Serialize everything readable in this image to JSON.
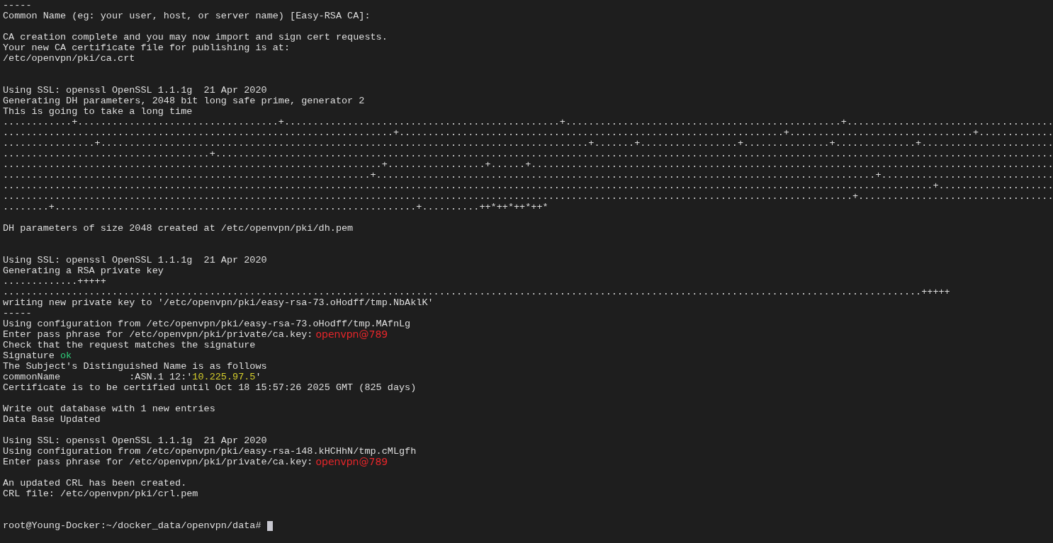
{
  "terminal": {
    "cursor": true,
    "lines": [
      {
        "kind": "text",
        "segments": [
          {
            "kind": "output",
            "text": "-----"
          }
        ]
      },
      {
        "kind": "text",
        "segments": [
          {
            "kind": "output",
            "text": "Common Name (eg: your user, host, or server name) [Easy-RSA CA]:"
          }
        ]
      },
      {
        "kind": "blank"
      },
      {
        "kind": "text",
        "segments": [
          {
            "kind": "output",
            "text": "CA creation complete and you may now import and sign cert requests."
          }
        ]
      },
      {
        "kind": "text",
        "segments": [
          {
            "kind": "output",
            "text": "Your new CA certificate file for publishing is at:"
          }
        ]
      },
      {
        "kind": "text",
        "segments": [
          {
            "kind": "output",
            "text": "/etc/openvpn/pki/ca.crt"
          }
        ]
      },
      {
        "kind": "blank"
      },
      {
        "kind": "blank"
      },
      {
        "kind": "text",
        "segments": [
          {
            "kind": "output",
            "text": "Using SSL: openssl OpenSSL 1.1.1g  21 Apr 2020"
          }
        ]
      },
      {
        "kind": "text",
        "segments": [
          {
            "kind": "output",
            "text": "Generating DH parameters, 2048 bit long safe prime, generator 2"
          }
        ]
      },
      {
        "kind": "text",
        "segments": [
          {
            "kind": "output",
            "text": "This is going to take a long time"
          }
        ]
      },
      {
        "kind": "text",
        "segments": [
          {
            "kind": "output",
            "text": "............+...................................+................................................+................................................+...................................."
          }
        ]
      },
      {
        "kind": "text",
        "segments": [
          {
            "kind": "output",
            "text": "....................................................................+...................................................................+................................+............."
          }
        ]
      },
      {
        "kind": "text",
        "segments": [
          {
            "kind": "output",
            "text": "................+.....................................................................................+.......+.................+...............+..............+......................."
          }
        ]
      },
      {
        "kind": "text",
        "segments": [
          {
            "kind": "output",
            "text": "....................................+.................................................................................................................................................."
          }
        ]
      },
      {
        "kind": "text",
        "segments": [
          {
            "kind": "output",
            "text": "..................................................................+.................+......+..........................................................................................."
          }
        ]
      },
      {
        "kind": "text",
        "segments": [
          {
            "kind": "output",
            "text": "................................................................+.......................................................................................+.............................."
          }
        ]
      },
      {
        "kind": "text",
        "segments": [
          {
            "kind": "output",
            "text": "..................................................................................................................................................................+...................."
          }
        ]
      },
      {
        "kind": "text",
        "segments": [
          {
            "kind": "output",
            "text": "....................................................................................................................................................+.................................."
          }
        ]
      },
      {
        "kind": "text",
        "segments": [
          {
            "kind": "output",
            "text": "........+...............................................................+..........++*++*++*++*"
          }
        ]
      },
      {
        "kind": "blank"
      },
      {
        "kind": "text",
        "segments": [
          {
            "kind": "output",
            "text": "DH parameters of size 2048 created at /etc/openvpn/pki/dh.pem"
          }
        ]
      },
      {
        "kind": "blank"
      },
      {
        "kind": "blank"
      },
      {
        "kind": "text",
        "segments": [
          {
            "kind": "output",
            "text": "Using SSL: openssl OpenSSL 1.1.1g  21 Apr 2020"
          }
        ]
      },
      {
        "kind": "text",
        "segments": [
          {
            "kind": "output",
            "text": "Generating a RSA private key"
          }
        ]
      },
      {
        "kind": "text",
        "segments": [
          {
            "kind": "output",
            "text": ".............+++++"
          }
        ]
      },
      {
        "kind": "text",
        "segments": [
          {
            "kind": "output",
            "text": "................................................................................................................................................................+++++"
          }
        ]
      },
      {
        "kind": "text",
        "segments": [
          {
            "kind": "output",
            "text": "writing new private key to '/etc/openvpn/pki/easy-rsa-73.oHodff/tmp.NbAklK'"
          }
        ]
      },
      {
        "kind": "text",
        "segments": [
          {
            "kind": "output",
            "text": "-----"
          }
        ]
      },
      {
        "kind": "text",
        "segments": [
          {
            "kind": "output",
            "text": "Using configuration from /etc/openvpn/pki/easy-rsa-73.oHodff/tmp.MAfnLg"
          }
        ]
      },
      {
        "kind": "text",
        "segments": [
          {
            "kind": "output",
            "text": "Enter pass phrase for /etc/openvpn/pki/private/ca.key:"
          },
          {
            "kind": "password",
            "text": "openvpn@789"
          }
        ]
      },
      {
        "kind": "text",
        "segments": [
          {
            "kind": "output",
            "text": "Check that the request matches the signature"
          }
        ]
      },
      {
        "kind": "text",
        "segments": [
          {
            "kind": "output",
            "text": "Signature"
          },
          {
            "kind": "ok",
            "text": "ok"
          }
        ]
      },
      {
        "kind": "text",
        "segments": [
          {
            "kind": "output",
            "text": "The Subject's Distinguished Name is as follows"
          }
        ]
      },
      {
        "kind": "text",
        "segments": [
          {
            "kind": "output",
            "text": "commonName            :ASN.1 12:'"
          },
          {
            "kind": "string",
            "text": "10.225.97.5"
          },
          {
            "kind": "output",
            "text": "'"
          }
        ]
      },
      {
        "kind": "text",
        "segments": [
          {
            "kind": "output",
            "text": "Certificate is to be certified until Oct 18 15:57:26 2025 GMT (825 days)"
          }
        ]
      },
      {
        "kind": "blank"
      },
      {
        "kind": "text",
        "segments": [
          {
            "kind": "output",
            "text": "Write out database with 1 new entries"
          }
        ]
      },
      {
        "kind": "text",
        "segments": [
          {
            "kind": "output",
            "text": "Data Base Updated"
          }
        ]
      },
      {
        "kind": "blank"
      },
      {
        "kind": "text",
        "segments": [
          {
            "kind": "output",
            "text": "Using SSL: openssl OpenSSL 1.1.1g  21 Apr 2020"
          }
        ]
      },
      {
        "kind": "text",
        "segments": [
          {
            "kind": "output",
            "text": "Using configuration from /etc/openvpn/pki/easy-rsa-148.kHCHhN/tmp.cMLgfh"
          }
        ]
      },
      {
        "kind": "text",
        "segments": [
          {
            "kind": "output",
            "text": "Enter pass phrase for /etc/openvpn/pki/private/ca.key:"
          },
          {
            "kind": "password",
            "text": "openvpn@789"
          }
        ]
      },
      {
        "kind": "blank"
      },
      {
        "kind": "text",
        "segments": [
          {
            "kind": "output",
            "text": "An updated CRL has been created."
          }
        ]
      },
      {
        "kind": "text",
        "segments": [
          {
            "kind": "output",
            "text": "CRL file: /etc/openvpn/pki/crl.pem"
          }
        ]
      },
      {
        "kind": "blank"
      },
      {
        "kind": "blank"
      },
      {
        "kind": "text",
        "segments": [
          {
            "kind": "prompt",
            "text": "root@Young-Docker:~/docker_data/openvpn/data#"
          }
        ]
      }
    ]
  }
}
